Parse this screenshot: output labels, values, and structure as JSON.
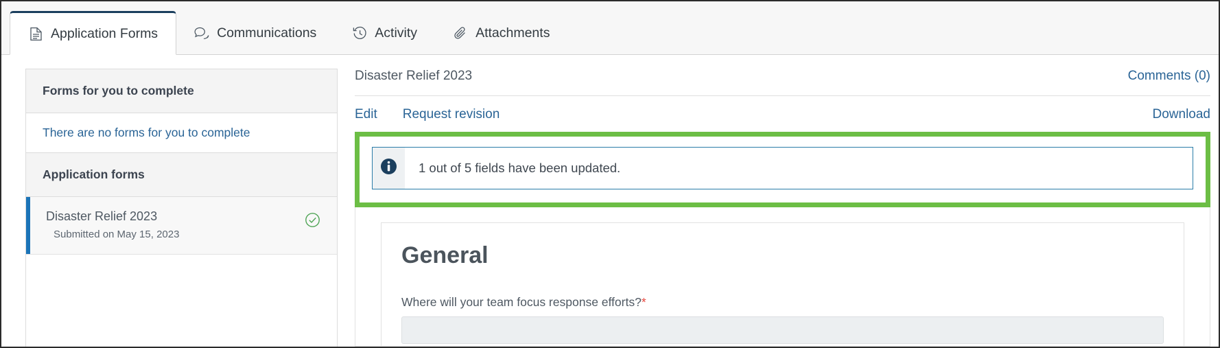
{
  "tabs": [
    {
      "label": "Application Forms",
      "icon": "document-icon",
      "active": true
    },
    {
      "label": "Communications",
      "icon": "chat-icon",
      "active": false
    },
    {
      "label": "Activity",
      "icon": "history-icon",
      "active": false
    },
    {
      "label": "Attachments",
      "icon": "paperclip-icon",
      "active": false
    }
  ],
  "sidebar": {
    "pending_header": "Forms for you to complete",
    "pending_empty_link": "There are no forms for you to complete",
    "application_header": "Application forms",
    "items": [
      {
        "title": "Disaster Relief 2023",
        "subtitle": "Submitted on May 15, 2023",
        "status_icon": "check-circle-icon",
        "selected": true
      }
    ]
  },
  "panel": {
    "title": "Disaster Relief 2023",
    "comments_label": "Comments (0)",
    "edit_label": "Edit",
    "request_revision_label": "Request revision",
    "download_label": "Download",
    "alert": {
      "icon": "info-circle-icon",
      "message": "1 out of 5 fields have been updated."
    },
    "form": {
      "section_title": "General",
      "question_label": "Where will your team focus response efforts?",
      "required_marker": "*",
      "answer_value": ""
    }
  },
  "colors": {
    "highlight": "#6cbe45",
    "link": "#2a6496",
    "active_tab_border": "#1b3f5e",
    "selected_item_bar": "#1b74b8",
    "alert_border": "#2a7ca8",
    "required": "#e8483f",
    "check": "#4fa455"
  }
}
